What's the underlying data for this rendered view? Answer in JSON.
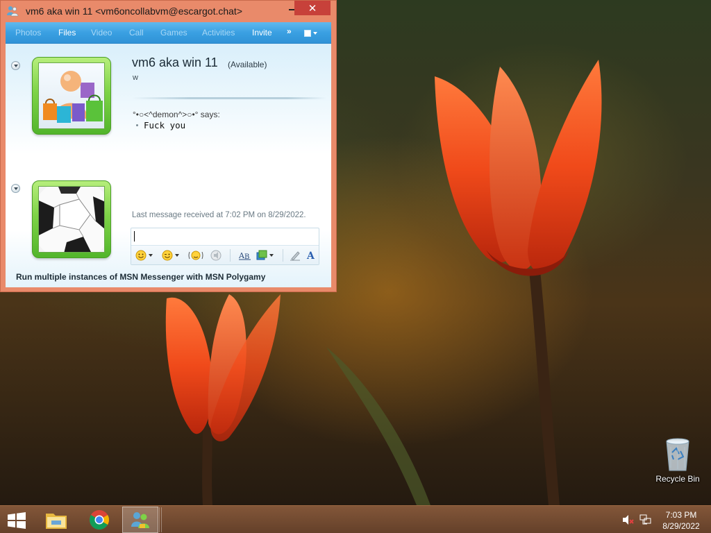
{
  "window": {
    "title": "vm6 aka win 11 <vm6oncollabvm@escargot.chat>",
    "close_glyph": "✕"
  },
  "toolbar": {
    "items": [
      "Photos",
      "Files",
      "Video",
      "Call",
      "Games",
      "Activities",
      "Invite"
    ],
    "more_glyph": "»"
  },
  "contact": {
    "name": "vm6 aka win 11",
    "status": "(Available)",
    "personal_message": "w"
  },
  "conversation": {
    "sender_line": "°•○<^demon^>○•° says:",
    "message": "Fuck you",
    "last_received": "Last message received at 7:02 PM on 8/29/2022."
  },
  "compose": {
    "value": ""
  },
  "promo": {
    "text": "Run multiple instances of MSN Messenger with MSN Polygamy"
  },
  "desktop": {
    "recycle_bin_label": "Recycle Bin"
  },
  "clock": {
    "time": "7:03 PM",
    "date": "8/29/2022"
  },
  "icons": {
    "title": "msn-messenger-icon",
    "emoticon": "smiley-icon",
    "wink": "wink-icon",
    "nudge": "nudge-icon",
    "voice_clip": "voice-clip-icon",
    "font": "font-icon",
    "background": "background-icon",
    "handwriting": "handwriting-icon",
    "text_color": "text-color-icon"
  },
  "colors": {
    "window_frame": "#e98a6a",
    "toolbar_blue": "#3aa0e2",
    "avatar_green": "#7ed347",
    "close_red": "#c7413a",
    "taskbar": "#78482a"
  }
}
